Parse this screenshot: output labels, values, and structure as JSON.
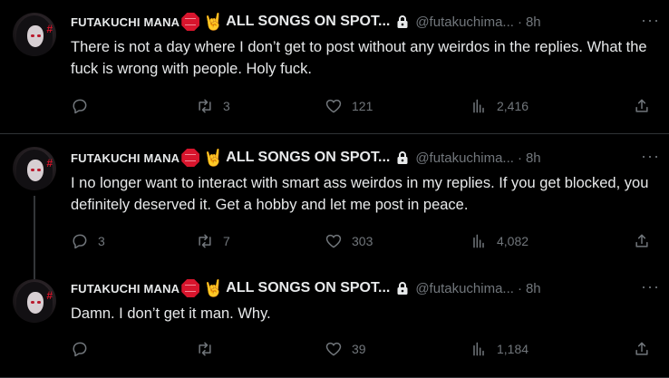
{
  "tweets": [
    {
      "name": "FUTAKUCHI MANA",
      "name_rest": "ALL SONGS ON SPOT...",
      "handle": "@futakuchima...",
      "dot": "·",
      "time": "8h",
      "more": "···",
      "text": "There is not a day where I don’t get to post without any weirdos in the replies. What the fuck is wrong with people. Holy fuck.",
      "replies": "",
      "reposts": "3",
      "likes": "121",
      "views": "2,416"
    },
    {
      "name": "FUTAKUCHI MANA",
      "name_rest": "ALL SONGS ON SPOT...",
      "handle": "@futakuchima...",
      "dot": "·",
      "time": "8h",
      "more": "···",
      "text": "I no longer want to interact with smart ass weirdos in my replies. If you get blocked, you definitely deserved it. Get a hobby and let me post in peace.",
      "replies": "3",
      "reposts": "7",
      "likes": "303",
      "views": "4,082"
    },
    {
      "name": "FUTAKUCHI MANA",
      "name_rest": "ALL SONGS ON SPOT...",
      "handle": "@futakuchima...",
      "dot": "·",
      "time": "8h",
      "more": "···",
      "text": "Damn. I don’t get it man. Why.",
      "replies": "",
      "reposts": "",
      "likes": "39",
      "views": "1,184"
    }
  ],
  "icons": {
    "badge_1": "stop-sign-icon",
    "badge_2": "horns-hand-icon",
    "protected": "lock-icon"
  },
  "colors": {
    "background": "#000000",
    "text": "#e7e9ea",
    "muted": "#71767b",
    "divider": "#2f3336",
    "stop_red": "#d8152d"
  }
}
